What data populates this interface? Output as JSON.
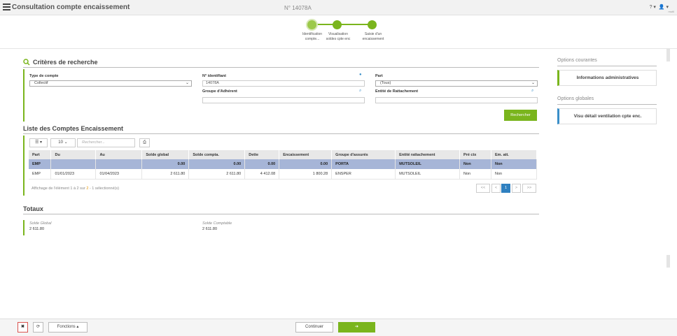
{
  "header": {
    "title": "Consultation compte encaissement",
    "dossier_number": "N° 14078A",
    "help_icon": "? ▾",
    "user_icon": "👤 ▾",
    "user_sub": "mutil"
  },
  "stepper": {
    "steps": [
      {
        "label_line1": "Identification",
        "label_line2": "compte..."
      },
      {
        "label_line1": "Visualisation",
        "label_line2": "soldes cpte enc"
      },
      {
        "label_line1": "Saisie d'un",
        "label_line2": "encaissement"
      }
    ],
    "accent": "#7ab51d"
  },
  "criteria": {
    "title": "Critères de recherche",
    "type_compte_label": "Type de compte",
    "type_compte_value": "Collectif",
    "identifiant_label": "N° identifiant",
    "identifiant_value": "14078A",
    "part_label": "Part",
    "part_value": "(Tous)",
    "groupe_label": "Groupe d'Adhérent",
    "groupe_value": "",
    "entite_label": "Entité de Rattachement",
    "entite_value": "",
    "search_button": "Rechercher"
  },
  "list": {
    "title": "Liste des Comptes Encaissement",
    "page_size": "10",
    "search_placeholder": "Rechercher...",
    "columns": [
      "Part",
      "Du",
      "Au",
      "Solde global",
      "Solde compta.",
      "Dette",
      "Encaissement",
      "Groupe d'assurés",
      "Entité rattachement",
      "Pré ctx",
      "Em. att."
    ],
    "rows": [
      [
        "EMP",
        "",
        "",
        "0.00",
        "0.00",
        "0.00",
        "0.00",
        "PORTA",
        "MUTSOLEIL",
        "Non",
        "Non"
      ],
      [
        "EMP",
        "01/01/2023",
        "01/04/2023",
        "2 611.80",
        "2 611.80",
        "4 412.08",
        "1 800.28",
        "ENSPER",
        "MUTSOLEIL",
        "Non",
        "Non"
      ]
    ],
    "footer_prefix": "Affichage de l'élément 1 à 2 sur",
    "footer_total": "2",
    "footer_suffix": "- 1 sélectionné(s)",
    "pager": [
      "<<",
      "<",
      "1",
      ">",
      ">>"
    ]
  },
  "totaux": {
    "title": "Totaux",
    "solde_global_label": "Solde Global",
    "solde_global_value": "2 611.80",
    "solde_comptable_label": "Solde Comptable",
    "solde_comptable_value": "2 611.80"
  },
  "right_panel": {
    "options_courantes_title": "Options courantes",
    "options_courantes_item": "Informations administratives",
    "options_globales_title": "Options globales",
    "options_globales_item": "Visu détail ventilation cpte enc."
  },
  "bottom": {
    "close_icon": "✖",
    "refresh_icon": "⟳",
    "fonctions_label": "Fonctions ▴",
    "continuer_label": "Continuer",
    "next_icon": "➔"
  }
}
